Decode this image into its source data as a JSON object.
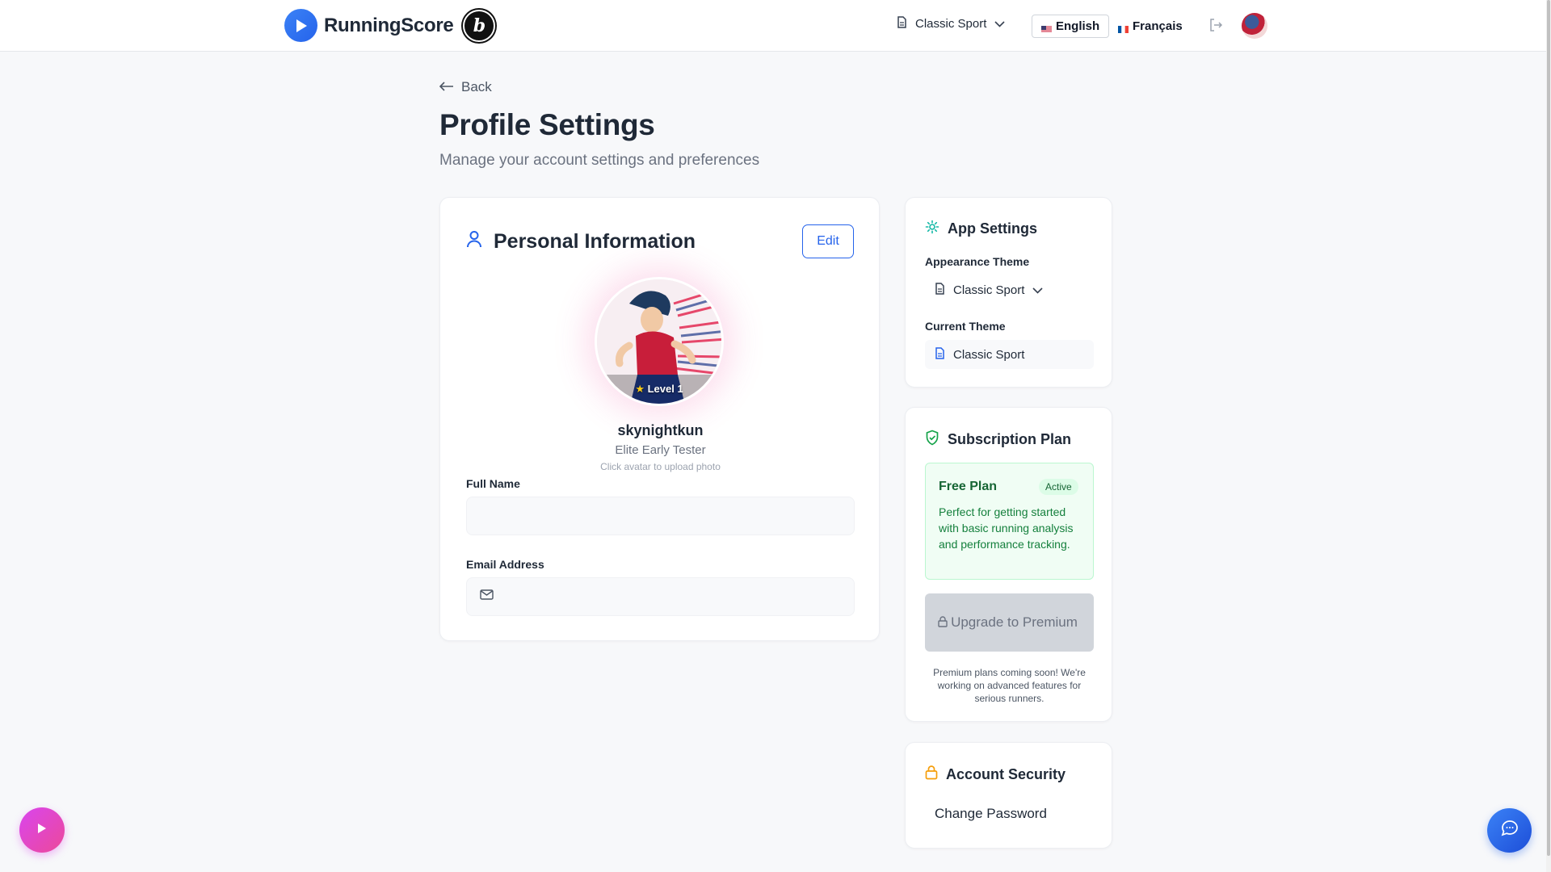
{
  "header": {
    "brand_name": "RunningScore",
    "brand_badge_letter": "b",
    "theme_select_label": "Classic Sport",
    "languages": [
      {
        "label": "English",
        "active": true
      },
      {
        "label": "Français",
        "active": false
      }
    ]
  },
  "page": {
    "back_label": "Back",
    "title": "Profile Settings",
    "subtitle": "Manage your account settings and preferences"
  },
  "personal_info": {
    "title": "Personal Information",
    "edit_label": "Edit",
    "avatar_level": "Level 1",
    "username": "skynightkun",
    "user_title": "Elite Early Tester",
    "upload_hint": "Click avatar to upload photo",
    "full_name_label": "Full Name",
    "full_name_value": "",
    "email_label": "Email Address",
    "email_value": ""
  },
  "app_settings": {
    "title": "App Settings",
    "appearance_label": "Appearance Theme",
    "appearance_value": "Classic Sport",
    "current_theme_label": "Current Theme",
    "current_theme_value": "Classic Sport"
  },
  "subscription": {
    "title": "Subscription Plan",
    "plan_name": "Free Plan",
    "plan_status": "Active",
    "plan_description": "Perfect for getting started with basic running analysis and performance tracking.",
    "upgrade_label": "Upgrade to Premium",
    "premium_note": "Premium plans coming soon! We're working on advanced features for serious runners."
  },
  "security": {
    "title": "Account Security",
    "change_password_label": "Change Password"
  },
  "colors": {
    "primary": "#2563eb",
    "success": "#16a34a",
    "warning": "#f59e0b",
    "fab_left": "#d946ef"
  },
  "icons": [
    "play-icon",
    "document-icon",
    "chevron-down-icon",
    "logout-icon",
    "arrow-left-icon",
    "user-icon",
    "gear-icon",
    "shield-check-icon",
    "lock-icon",
    "mail-icon",
    "chat-icon",
    "star-icon"
  ]
}
